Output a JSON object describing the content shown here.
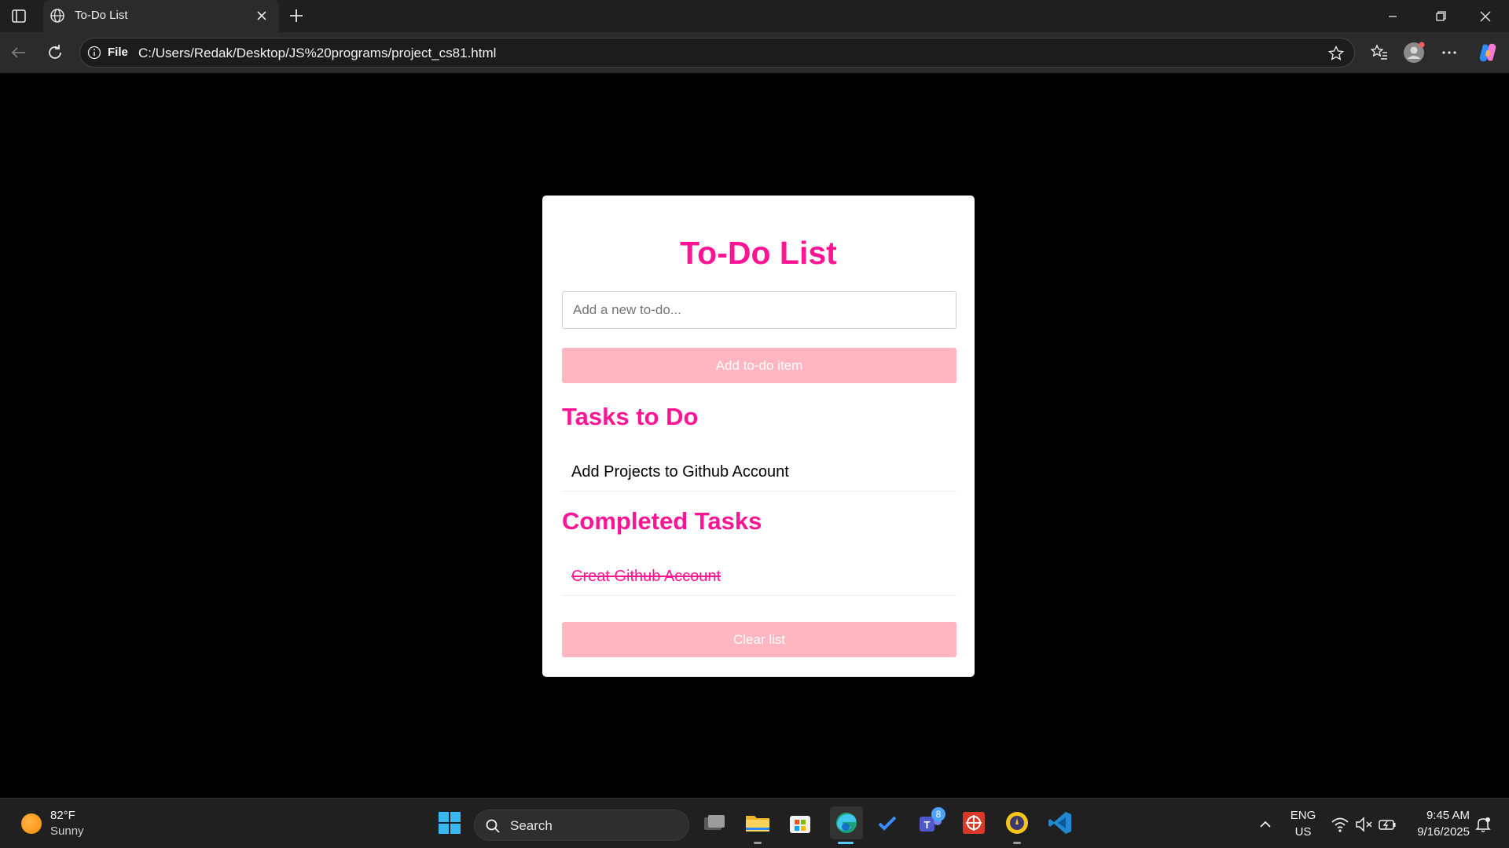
{
  "browser": {
    "tab_title": "To-Do List",
    "url_scheme": "File",
    "url": "C:/Users/Redak/Desktop/JS%20programs/project_cs81.html"
  },
  "page": {
    "heading": "To-Do List",
    "input": {
      "placeholder": "Add a new to-do...",
      "value": ""
    },
    "add_button": "Add to-do item",
    "tasks_heading": "Tasks to Do",
    "tasks": [
      "Add Projects to Github Account"
    ],
    "completed_heading": "Completed Tasks",
    "completed": [
      "Creat Github Account"
    ],
    "clear_button": "Clear list",
    "colors": {
      "accent": "#ff1493",
      "button": "#ffb6c1",
      "background": "#000000"
    }
  },
  "taskbar": {
    "weather": {
      "temp": "82°F",
      "condition": "Sunny"
    },
    "search_label": "Search",
    "apps": [
      "task-view-icon",
      "file-explorer-icon",
      "store-icon",
      "edge-icon",
      "todo-icon",
      "teams-icon",
      "app-red-icon",
      "app-yellow-icon",
      "vscode-icon"
    ],
    "teams_badge": "8",
    "lang_top": "ENG",
    "lang_bottom": "US",
    "time": "9:45 AM",
    "date": "9/16/2025"
  }
}
